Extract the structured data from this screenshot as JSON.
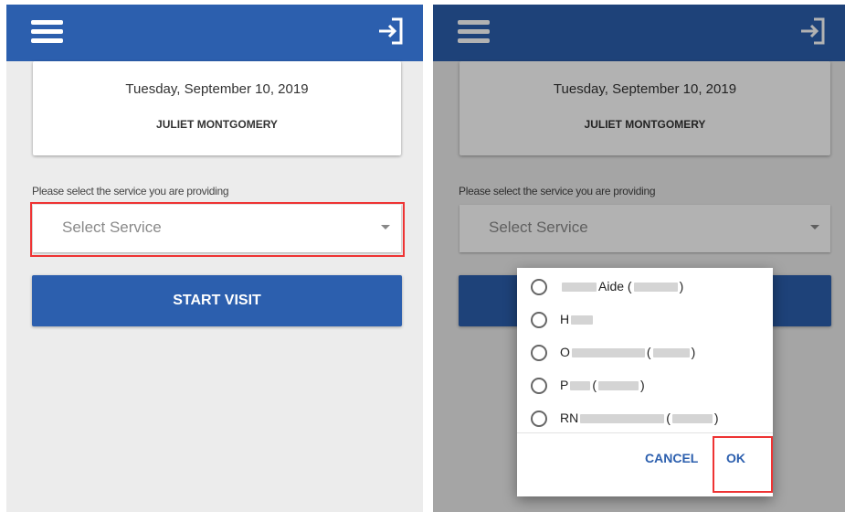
{
  "screen1": {
    "date": "Tuesday, September 10, 2019",
    "client_name": "JULIET MONTGOMERY",
    "service_prompt": "Please select the service you are providing",
    "select_placeholder": "Select Service",
    "start_button": "START VISIT"
  },
  "screen2": {
    "date": "Tuesday, September 10, 2019",
    "client_name": "JULIET MONTGOMERY",
    "service_prompt": "Please select the service you are providing",
    "select_placeholder": "Select Service",
    "dialog": {
      "options": [
        {
          "prefix": "",
          "suffix": "Aide ("
        },
        {
          "prefix": "H",
          "suffix": ""
        },
        {
          "prefix": "O",
          "suffix": "("
        },
        {
          "prefix": "P",
          "suffix": "("
        },
        {
          "prefix": "RN",
          "suffix": "("
        }
      ],
      "cancel_label": "CANCEL",
      "ok_label": "OK"
    }
  },
  "icons": {
    "menu": "hamburger-menu-icon",
    "logout": "logout-arrow-icon",
    "dropdown": "caret-down-icon",
    "radio": "radio-unchecked-icon"
  },
  "colors": {
    "appbar": "#2c5fae",
    "highlight": "#e33333",
    "background": "#ececec"
  }
}
